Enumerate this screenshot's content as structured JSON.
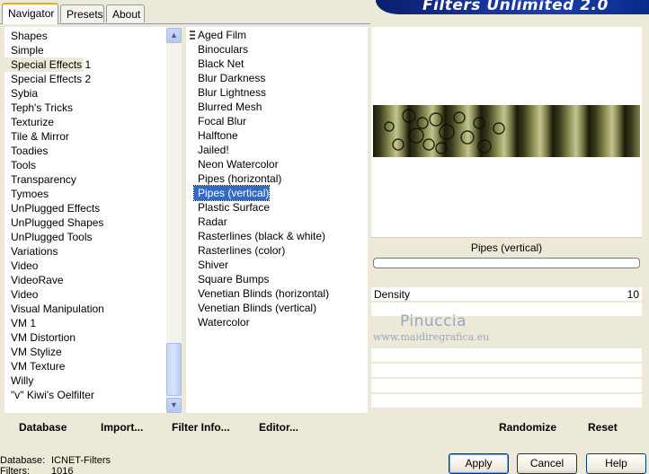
{
  "tabs": [
    "Navigator",
    "Presets",
    "About"
  ],
  "banner_title": "Filters Unlimited 2.0",
  "categories": [
    "Shapes",
    "Simple",
    "Special Effects 1",
    "Special Effects 2",
    "Sybia",
    "Teph's Tricks",
    "Texturize",
    "Tile & Mirror",
    "Toadies",
    "Tools",
    "Transparency",
    "Tymoes",
    "UnPlugged Effects",
    "UnPlugged Shapes",
    "UnPlugged Tools",
    "Variations",
    "Video",
    "VideoRave",
    "Video",
    "Visual Manipulation",
    "VM 1",
    "VM Distortion",
    "VM Stylize",
    "VM Texture",
    "Willy",
    "\"v\" Kiwi's Oelfilter"
  ],
  "selected_category": "Special Effects 1",
  "filters": [
    "Aged Film",
    "Binoculars",
    "Black Net",
    "Blur Darkness",
    "Blur Lightness",
    "Blurred Mesh",
    "Focal Blur",
    "Halftone",
    "Jailed!",
    "Neon Watercolor",
    "Pipes (horizontal)",
    "Pipes (vertical)",
    "Plastic Surface",
    "Radar",
    "Rasterlines (black & white)",
    "Rasterlines (color)",
    "Shiver",
    "Square Bumps",
    "Venetian Blinds (horizontal)",
    "Venetian Blinds (vertical)",
    "Watercolor"
  ],
  "selected_filter": "Pipes (vertical)",
  "preview": {
    "filter_name": "Pipes (vertical)",
    "progress": 0
  },
  "params": [
    {
      "label": "Density",
      "value": "10"
    }
  ],
  "watermark": {
    "name": "Pinuccia",
    "url": "www.maidiregrafica.eu"
  },
  "buttons": {
    "database": "Database",
    "import": "Import...",
    "filter_info": "Filter Info...",
    "editor": "Editor...",
    "randomize": "Randomize",
    "reset": "Reset",
    "apply": "Apply",
    "cancel": "Cancel",
    "help": "Help"
  },
  "footer": {
    "database_label": "Database:",
    "database_value": "ICNET-Filters",
    "filters_label": "Filters:",
    "filters_value": "1016"
  },
  "colors": {
    "selection": "#316ac5",
    "banner": "#1c3fae",
    "tab_highlight": "#f5a623"
  },
  "icons": {
    "scroll_up": "chevron-up-icon",
    "scroll_down": "chevron-down-icon",
    "drag_handle": "drag-handle-icon"
  }
}
